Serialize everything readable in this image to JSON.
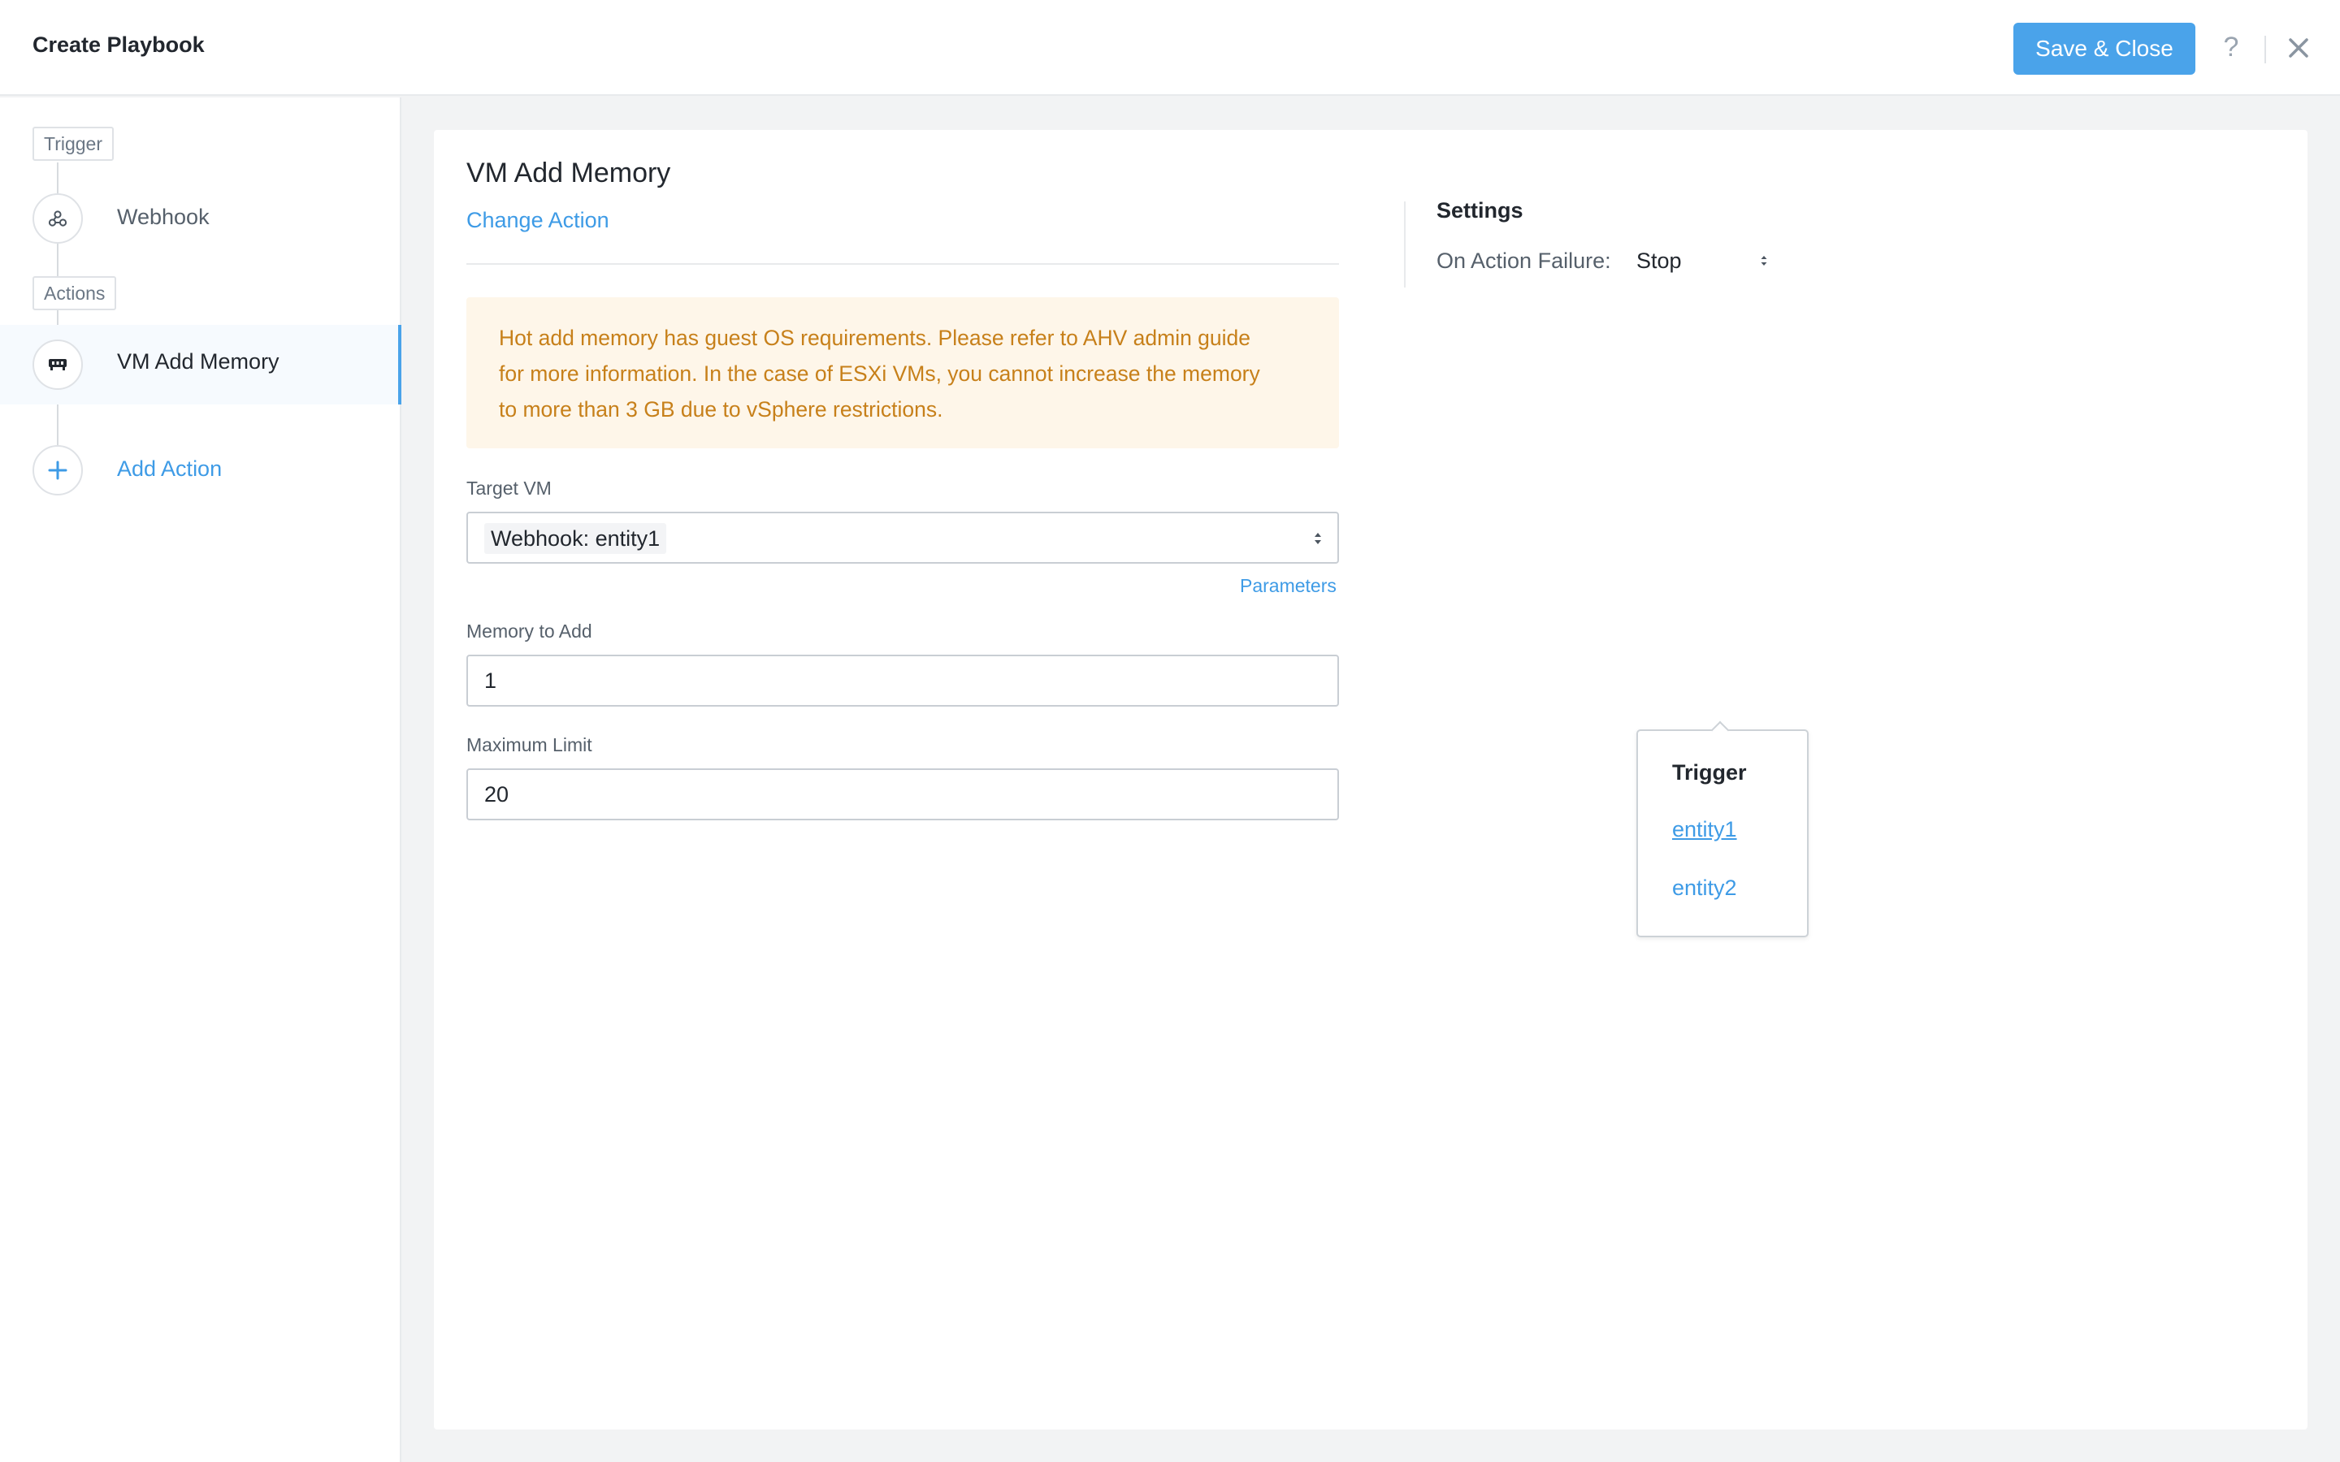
{
  "header": {
    "title": "Create Playbook",
    "save_label": "Save & Close",
    "help_label": "?"
  },
  "sidebar": {
    "trigger_tag": "Trigger",
    "trigger_item": "Webhook",
    "actions_tag": "Actions",
    "action_item": "VM Add Memory",
    "add_action": "Add Action"
  },
  "main": {
    "action_title": "VM Add Memory",
    "change_action": "Change Action",
    "warning_lines": [
      "Hot add memory has guest OS requirements. Please refer to AHV admin guide",
      "for more information. In the case of ESXi VMs, you cannot increase the memory",
      "to more than 3 GB due to vSphere restrictions."
    ],
    "target_vm_label": "Target VM",
    "target_vm_value": "Webhook: entity1",
    "parameters_link": "Parameters",
    "memory_label": "Memory to Add",
    "memory_value": "1",
    "max_label": "Maximum Limit",
    "max_value": "20"
  },
  "settings": {
    "title": "Settings",
    "failure_label": "On Action Failure:",
    "failure_value": "Stop"
  },
  "popover": {
    "heading": "Trigger",
    "items": [
      "entity1",
      "entity2"
    ]
  },
  "colors": {
    "accent": "#4aa3ea",
    "link": "#3e9be6",
    "warning_bg": "#fef6e9",
    "warning_text": "#c7801a"
  },
  "icons": {
    "webhook": "webhook-icon",
    "memory": "memory-icon",
    "add": "plus-icon",
    "help": "question-icon",
    "close": "close-icon"
  }
}
